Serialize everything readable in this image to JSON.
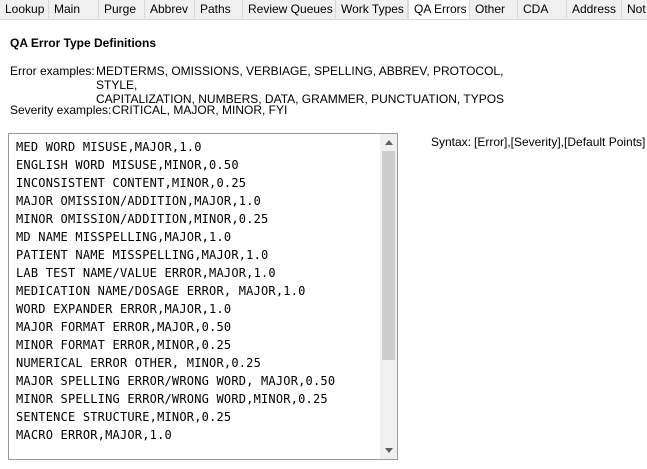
{
  "tabs": [
    {
      "label": "Lookup"
    },
    {
      "label": "Main"
    },
    {
      "label": "Purge"
    },
    {
      "label": "Abbrev"
    },
    {
      "label": "Paths"
    },
    {
      "label": "Review Queues"
    },
    {
      "label": "Work Types"
    },
    {
      "label": "QA Errors",
      "active": true
    },
    {
      "label": "Other"
    },
    {
      "label": "CDA"
    },
    {
      "label": "Address"
    },
    {
      "label": "Not"
    }
  ],
  "section": {
    "title": "QA Error Type Definitions",
    "error_examples_label": "Error examples:",
    "error_examples_line1": "MEDTERMS, OMISSIONS, VERBIAGE, SPELLING, ABBREV, PROTOCOL, STYLE,",
    "error_examples_line2": "CAPITALIZATION, NUMBERS, DATA, GRAMMER, PUNCTUATION, TYPOS",
    "severity_examples_label": "Severity examples:",
    "severity_examples_text": "CRITICAL, MAJOR, MINOR, FYI",
    "syntax_label": "Syntax:",
    "syntax_text": "[Error],[Severity],[Default Points]"
  },
  "error_definitions": [
    "MED WORD MISUSE,MAJOR,1.0",
    "ENGLISH WORD MISUSE,MINOR,0.50",
    "INCONSISTENT CONTENT,MINOR,0.25",
    "MAJOR OMISSION/ADDITION,MAJOR,1.0",
    "MINOR OMISSION/ADDITION,MINOR,0.25",
    "MD NAME MISSPELLING,MAJOR,1.0",
    "PATIENT NAME MISSPELLING,MAJOR,1.0",
    "LAB TEST NAME/VALUE ERROR,MAJOR,1.0",
    "MEDICATION NAME/DOSAGE ERROR, MAJOR,1.0",
    "WORD EXPANDER ERROR,MAJOR,1.0",
    "MAJOR FORMAT ERROR,MAJOR,0.50",
    "MINOR FORMAT ERROR,MINOR,0.25",
    "NUMERICAL ERROR OTHER, MINOR,0.25",
    "MAJOR SPELLING ERROR/WRONG WORD, MAJOR,0.50",
    "MINOR SPELLING ERROR/WRONG WORD,MINOR,0.25",
    "SENTENCE STRUCTURE,MINOR,0.25",
    "MACRO ERROR,MAJOR,1.0"
  ],
  "icons": {
    "scroll_up": "triangle-up-icon",
    "scroll_down": "triangle-down-icon"
  }
}
